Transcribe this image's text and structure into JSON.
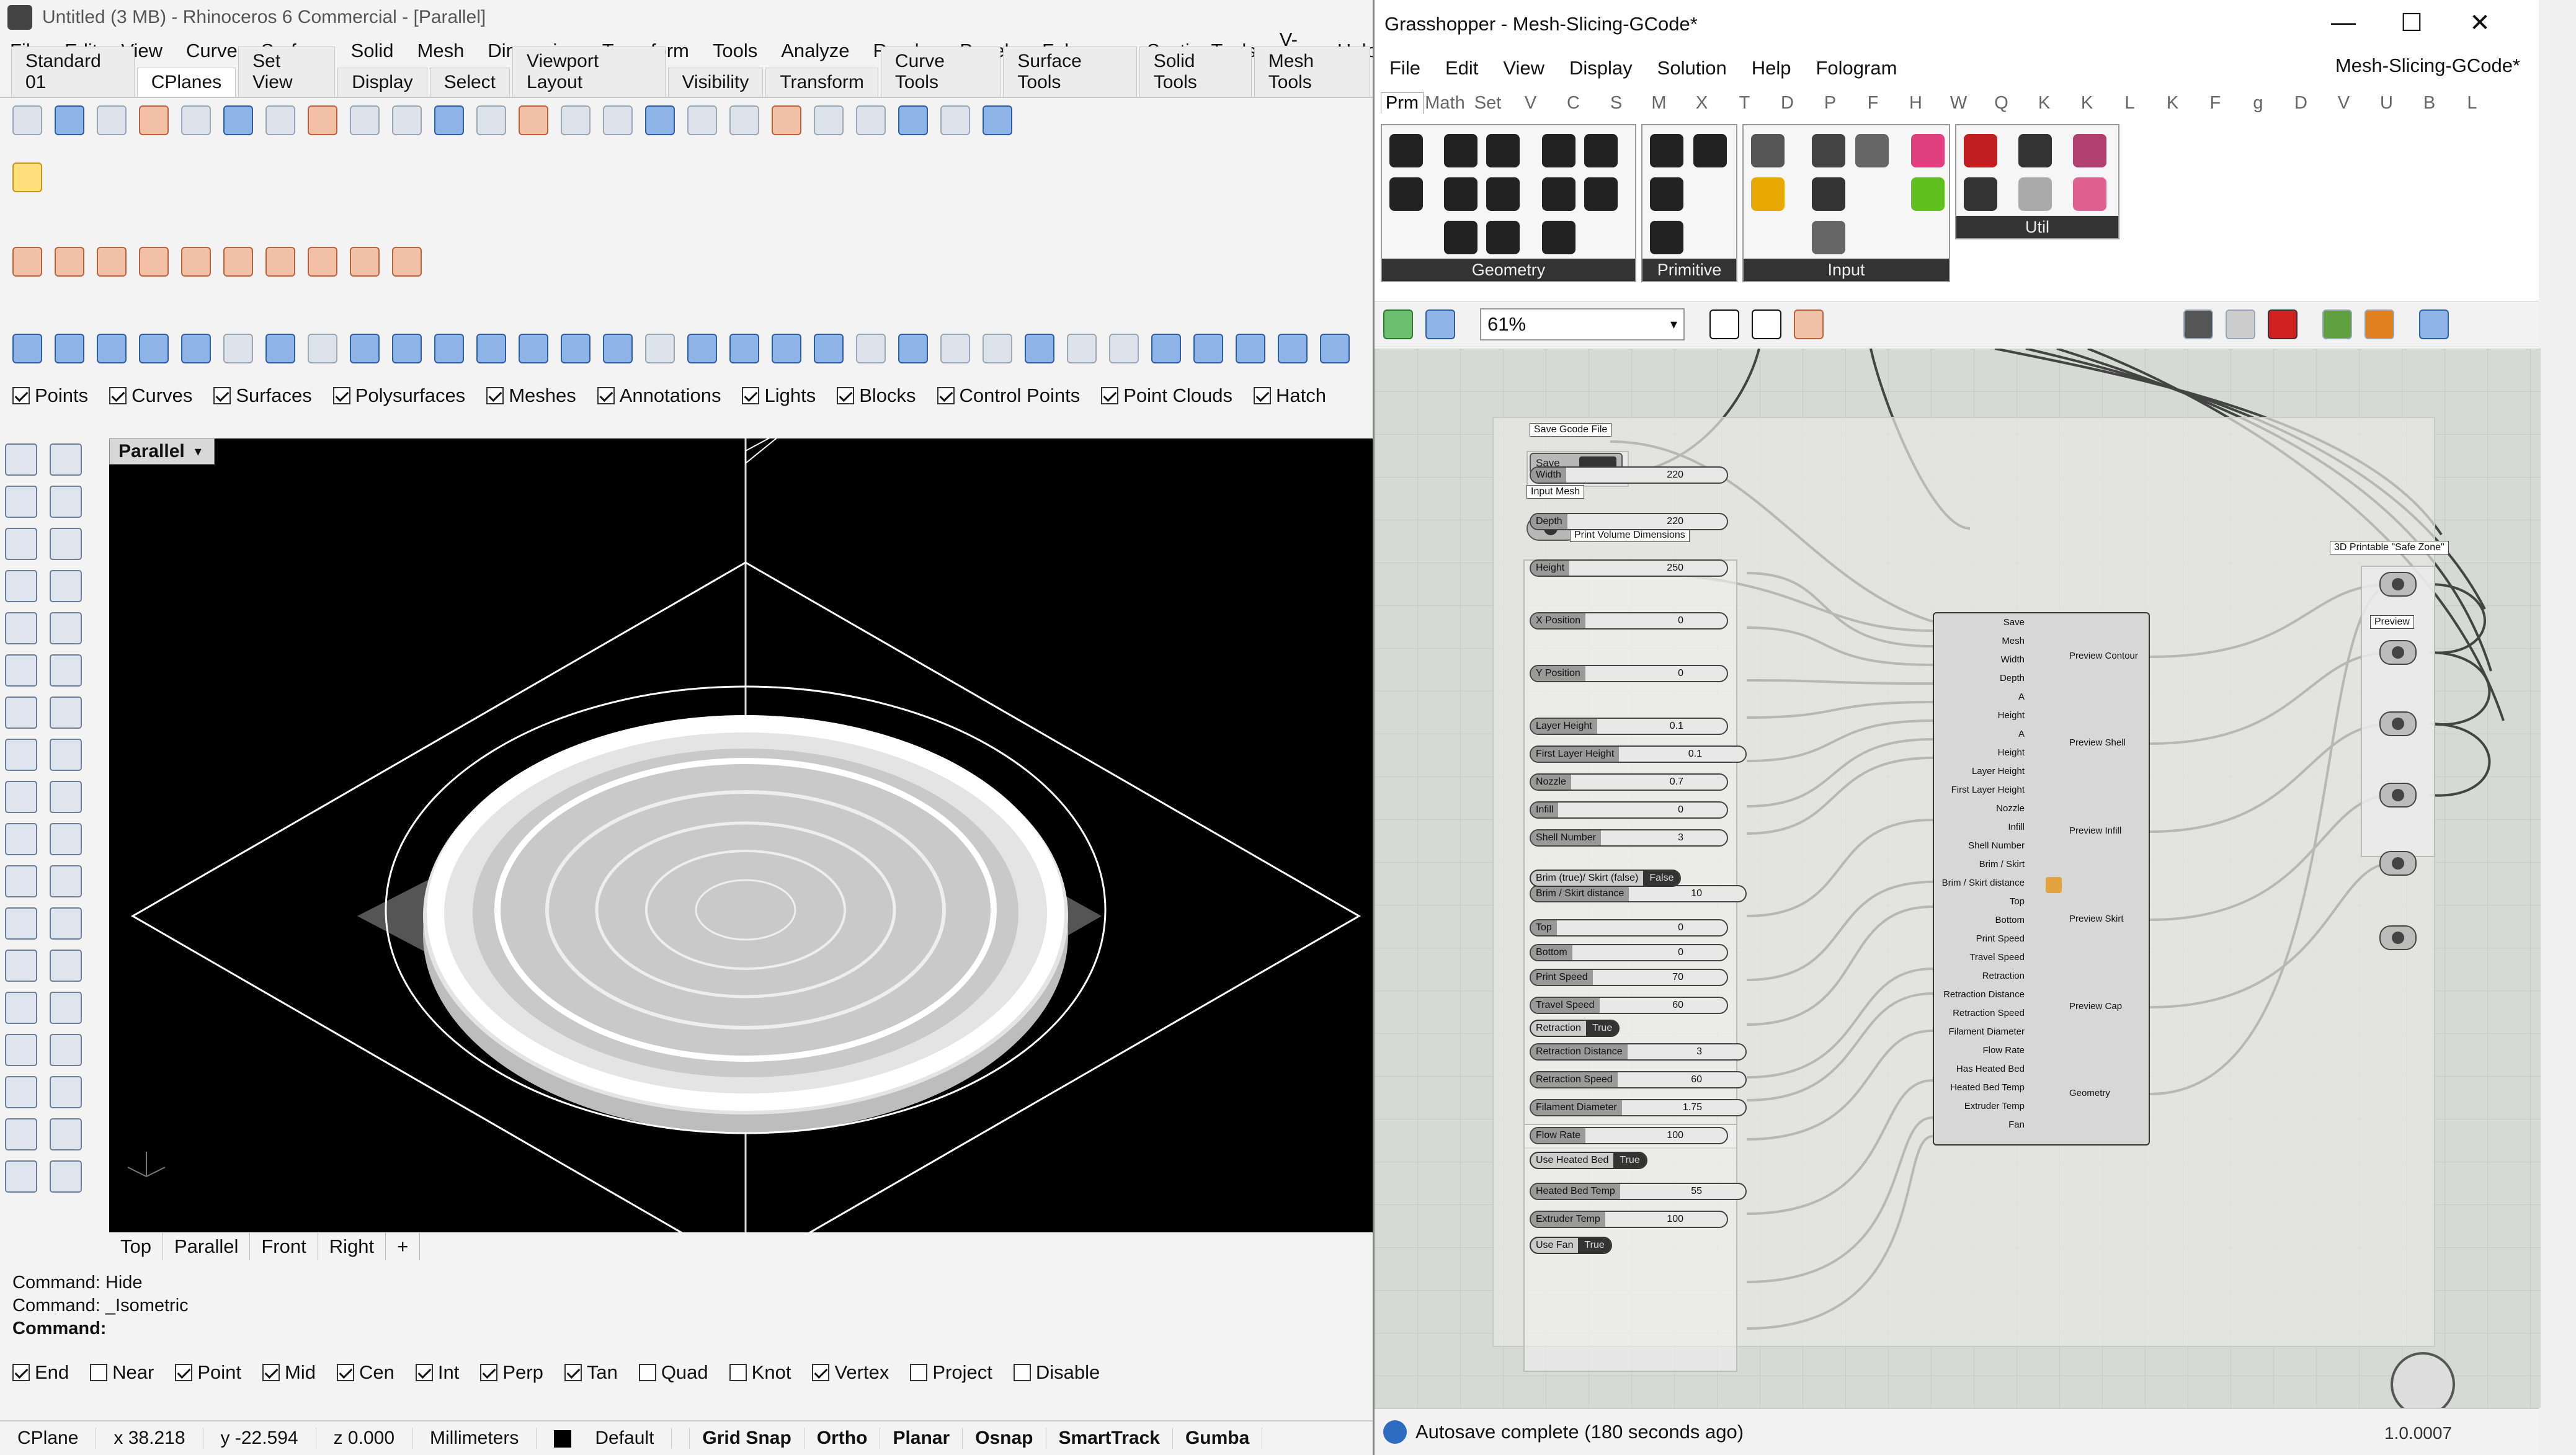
{
  "rhino": {
    "title": "Untitled (3 MB) - Rhinoceros 6 Commercial - [Parallel]",
    "menu": [
      "File",
      "Edit",
      "View",
      "Curve",
      "Surface",
      "Solid",
      "Mesh",
      "Dimension",
      "Transform",
      "Tools",
      "Analyze",
      "Render",
      "Panels",
      "Fologram",
      "SectionTools",
      "V-Ray",
      "Help"
    ],
    "tabs": [
      "Standard 01",
      "CPlanes",
      "Set View",
      "Display",
      "Select",
      "Viewport Layout",
      "Visibility",
      "Transform",
      "Curve Tools",
      "Surface Tools",
      "Solid Tools",
      "Mesh Tools"
    ],
    "active_tab": "CPlanes",
    "filters": [
      {
        "label": "Points",
        "checked": true
      },
      {
        "label": "Curves",
        "checked": true
      },
      {
        "label": "Surfaces",
        "checked": true
      },
      {
        "label": "Polysurfaces",
        "checked": true
      },
      {
        "label": "Meshes",
        "checked": true
      },
      {
        "label": "Annotations",
        "checked": true
      },
      {
        "label": "Lights",
        "checked": true
      },
      {
        "label": "Blocks",
        "checked": true
      },
      {
        "label": "Control Points",
        "checked": true
      },
      {
        "label": "Point Clouds",
        "checked": true
      },
      {
        "label": "Hatch",
        "checked": true
      }
    ],
    "viewport": {
      "label": "Parallel",
      "tabs": [
        "Top",
        "Parallel",
        "Front",
        "Right",
        "+"
      ]
    },
    "command_history": [
      "Command: Hide",
      "Command: _Isometric",
      "Command:"
    ],
    "osnaps": [
      {
        "label": "End",
        "checked": true
      },
      {
        "label": "Near",
        "checked": false
      },
      {
        "label": "Point",
        "checked": true
      },
      {
        "label": "Mid",
        "checked": true
      },
      {
        "label": "Cen",
        "checked": true
      },
      {
        "label": "Int",
        "checked": true
      },
      {
        "label": "Perp",
        "checked": true
      },
      {
        "label": "Tan",
        "checked": true
      },
      {
        "label": "Quad",
        "checked": false
      },
      {
        "label": "Knot",
        "checked": false
      },
      {
        "label": "Vertex",
        "checked": true
      },
      {
        "label": "Project",
        "checked": false
      },
      {
        "label": "Disable",
        "checked": false
      }
    ],
    "status": {
      "cplane": "CPlane",
      "x": "x 38.218",
      "y": "y -22.594",
      "z": "z 0.000",
      "units": "Millimeters",
      "layer": "Default",
      "toggles": [
        "Grid Snap",
        "Ortho",
        "Planar",
        "Osnap",
        "SmartTrack",
        "Gumba"
      ]
    }
  },
  "gh": {
    "title": "Grasshopper - Mesh-Slicing-GCode*",
    "menu": [
      "File",
      "Edit",
      "View",
      "Display",
      "Solution",
      "Help",
      "Fologram"
    ],
    "doc_name": "Mesh-Slicing-GCode*",
    "categories": [
      "Prm",
      "Math",
      "Set",
      "V",
      "C",
      "S",
      "M",
      "X",
      "T",
      "D",
      "P",
      "F",
      "H",
      "W",
      "Q",
      "K",
      "K",
      "L",
      "K",
      "F",
      "g",
      "D",
      "V",
      "U",
      "B",
      "L"
    ],
    "palettes": [
      "Geometry",
      "Primitive",
      "Input",
      "Util"
    ],
    "zoom": "61%",
    "status": "Autosave complete (180 seconds ago)",
    "version": "1.0.0007",
    "canvas": {
      "save_group": "Save Gcode File",
      "save_btn": "Save",
      "input_group": "Input Mesh",
      "print_volume": "Print Volume Dimensions",
      "sliders": [
        {
          "name": "Width",
          "value": "220"
        },
        {
          "name": "Depth",
          "value": "220"
        },
        {
          "name": "Height",
          "value": "250"
        },
        {
          "name": "X Position",
          "value": "0"
        },
        {
          "name": "Y Position",
          "value": "0"
        },
        {
          "name": "Layer Height",
          "value": "0.1"
        },
        {
          "name": "First Layer Height",
          "value": "0.1"
        },
        {
          "name": "Nozzle",
          "value": "0.7"
        },
        {
          "name": "Infill",
          "value": "0"
        },
        {
          "name": "Shell Number",
          "value": "3"
        },
        {
          "name": "Brim / Skirt distance",
          "value": "10"
        },
        {
          "name": "Top",
          "value": "0"
        },
        {
          "name": "Bottom",
          "value": "0"
        },
        {
          "name": "Print Speed",
          "value": "70"
        },
        {
          "name": "Travel Speed",
          "value": "60"
        },
        {
          "name": "Retraction Distance",
          "value": "3"
        },
        {
          "name": "Retraction Speed",
          "value": "60"
        },
        {
          "name": "Filament Diameter",
          "value": "1.75"
        },
        {
          "name": "Flow Rate",
          "value": "100"
        },
        {
          "name": "Heated Bed Temp",
          "value": "55"
        },
        {
          "name": "Extruder Temp",
          "value": "100"
        }
      ],
      "toggles": [
        {
          "name": "Brim (true)/ Skirt (false)",
          "value": "False"
        },
        {
          "name": "Retraction",
          "value": "True"
        },
        {
          "name": "Use Heated Bed",
          "value": "True"
        },
        {
          "name": "Use Fan",
          "value": "True"
        }
      ],
      "main_inputs": [
        "Save",
        "Mesh",
        "Width",
        "Depth",
        "A",
        "Height",
        "A",
        "Height",
        "Layer Height",
        "First Layer Height",
        "Nozzle",
        "Infill",
        "Shell Number",
        "Brim / Skirt",
        "Brim / Skirt distance",
        "Top",
        "Bottom",
        "Print Speed",
        "Travel Speed",
        "Retraction",
        "Retraction Distance",
        "Retraction Speed",
        "Filament Diameter",
        "Flow Rate",
        "Has Heated Bed",
        "Heated Bed Temp",
        "Extruder Temp",
        "Fan"
      ],
      "main_outputs": [
        "Preview Contour",
        "Preview Shell",
        "Preview Infill",
        "Preview Skirt",
        "Preview Cap",
        "Geometry"
      ],
      "preview_group": "3D Printable \"Safe Zone\"",
      "preview_label": "Preview"
    }
  }
}
